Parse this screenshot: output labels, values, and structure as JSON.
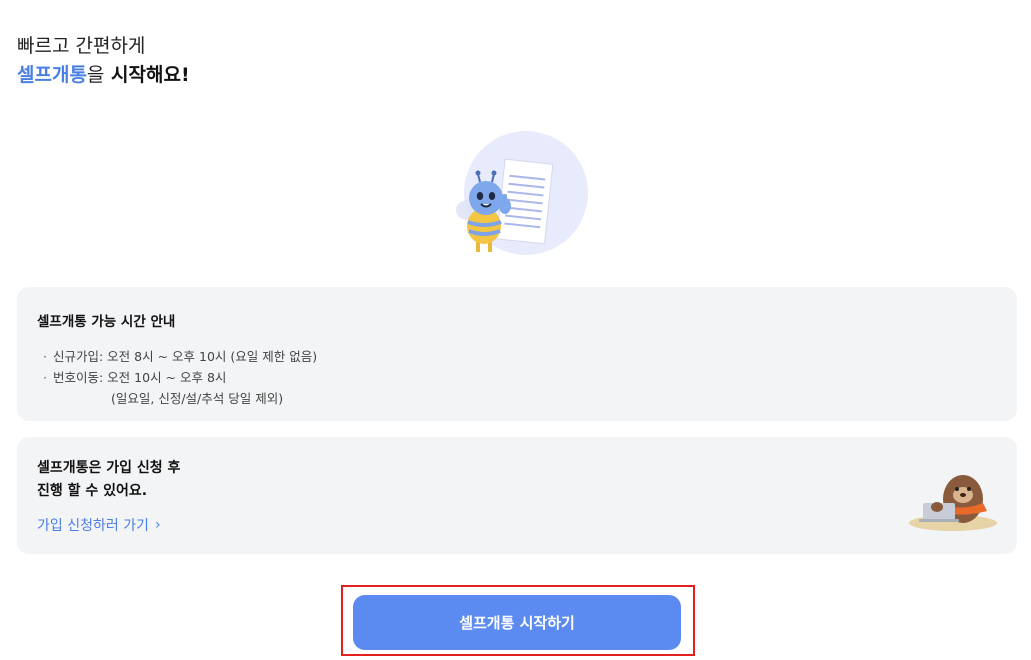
{
  "heading": {
    "line1": "빠르고 간편하게",
    "brand": "셀프개통",
    "particle": "을",
    "action": " 시작해요!"
  },
  "hero": {
    "icon": "bee-mascot-document-icon"
  },
  "info_card": {
    "title": "셀프개통 가능 시간 안내",
    "items": [
      {
        "text": "신규가입: 오전 8시 ~ 오후 10시 (요일 제한 없음)"
      },
      {
        "text": "번호이동: 오전 10시 ~ 오후 8시",
        "sub": "(일요일, 신정/설/추석 당일 제외)"
      }
    ]
  },
  "signup_card": {
    "line1": "셀프개통은 가입 신청 후",
    "line2": "진행 할 수 있어요.",
    "link_label": "가입 신청하러 가기",
    "icon": "mole-laptop-mascot-icon"
  },
  "cta": {
    "label": "셀프개통 시작하기"
  },
  "colors": {
    "accent": "#5b8af0",
    "brand_text": "#4a7fe4",
    "card_bg": "#f3f4f6",
    "highlight": "#e32020"
  }
}
